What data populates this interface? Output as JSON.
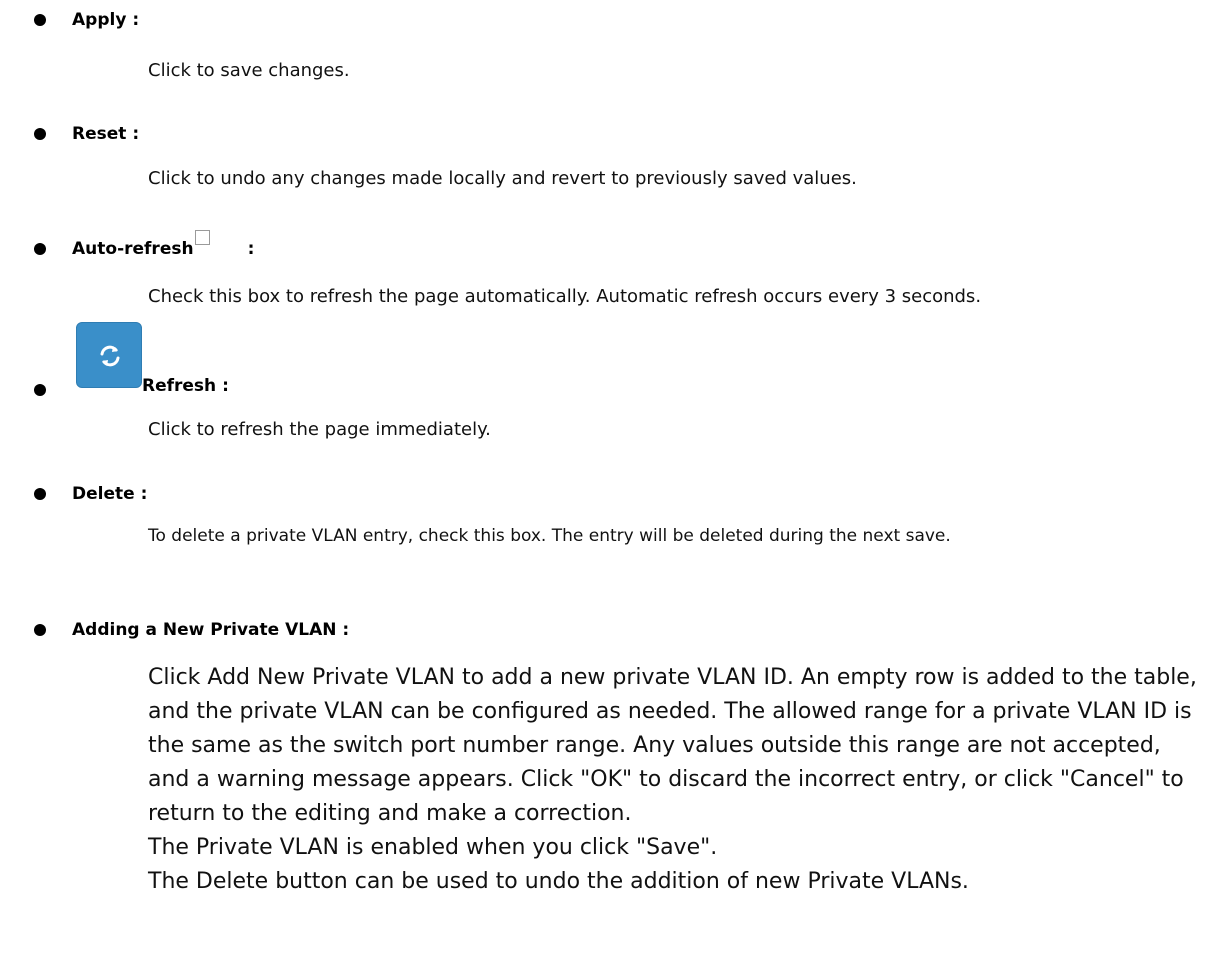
{
  "items": [
    {
      "heading": "Apply :",
      "description": "Click to save changes."
    },
    {
      "heading": "Reset :",
      "description": "Click to undo any changes made locally and revert to previously saved values."
    },
    {
      "heading": "Auto-refresh",
      "heading_suffix": ":",
      "description": "Check this box to refresh the page automatically. Automatic refresh occurs every 3 seconds."
    },
    {
      "heading": "Refresh :",
      "description": "Click to refresh the page immediately."
    },
    {
      "heading": "Delete :",
      "description": "To delete a private VLAN entry, check this box. The entry will be deleted during the next save."
    },
    {
      "heading": "Adding a New Private VLAN :",
      "description_lines": [
        "Click Add New Private VLAN to add a new private VLAN ID. An empty row is added to the table, and the private VLAN can be configured as needed. The allowed range for a private VLAN ID is the same as the switch port number range. Any values outside this range are not accepted, and a warning message appears. Click \"OK\" to discard the incorrect entry, or click \"Cancel\" to return to the editing and make a correction.",
        "The Private VLAN is enabled when you click \"Save\".",
        "The Delete button can be used to undo the addition of new Private VLANs."
      ]
    }
  ],
  "icons": {
    "auto_refresh_checkbox": "checkbox-icon",
    "refresh_button": "refresh-icon",
    "refresh_button_color": "#3a8fc9"
  }
}
